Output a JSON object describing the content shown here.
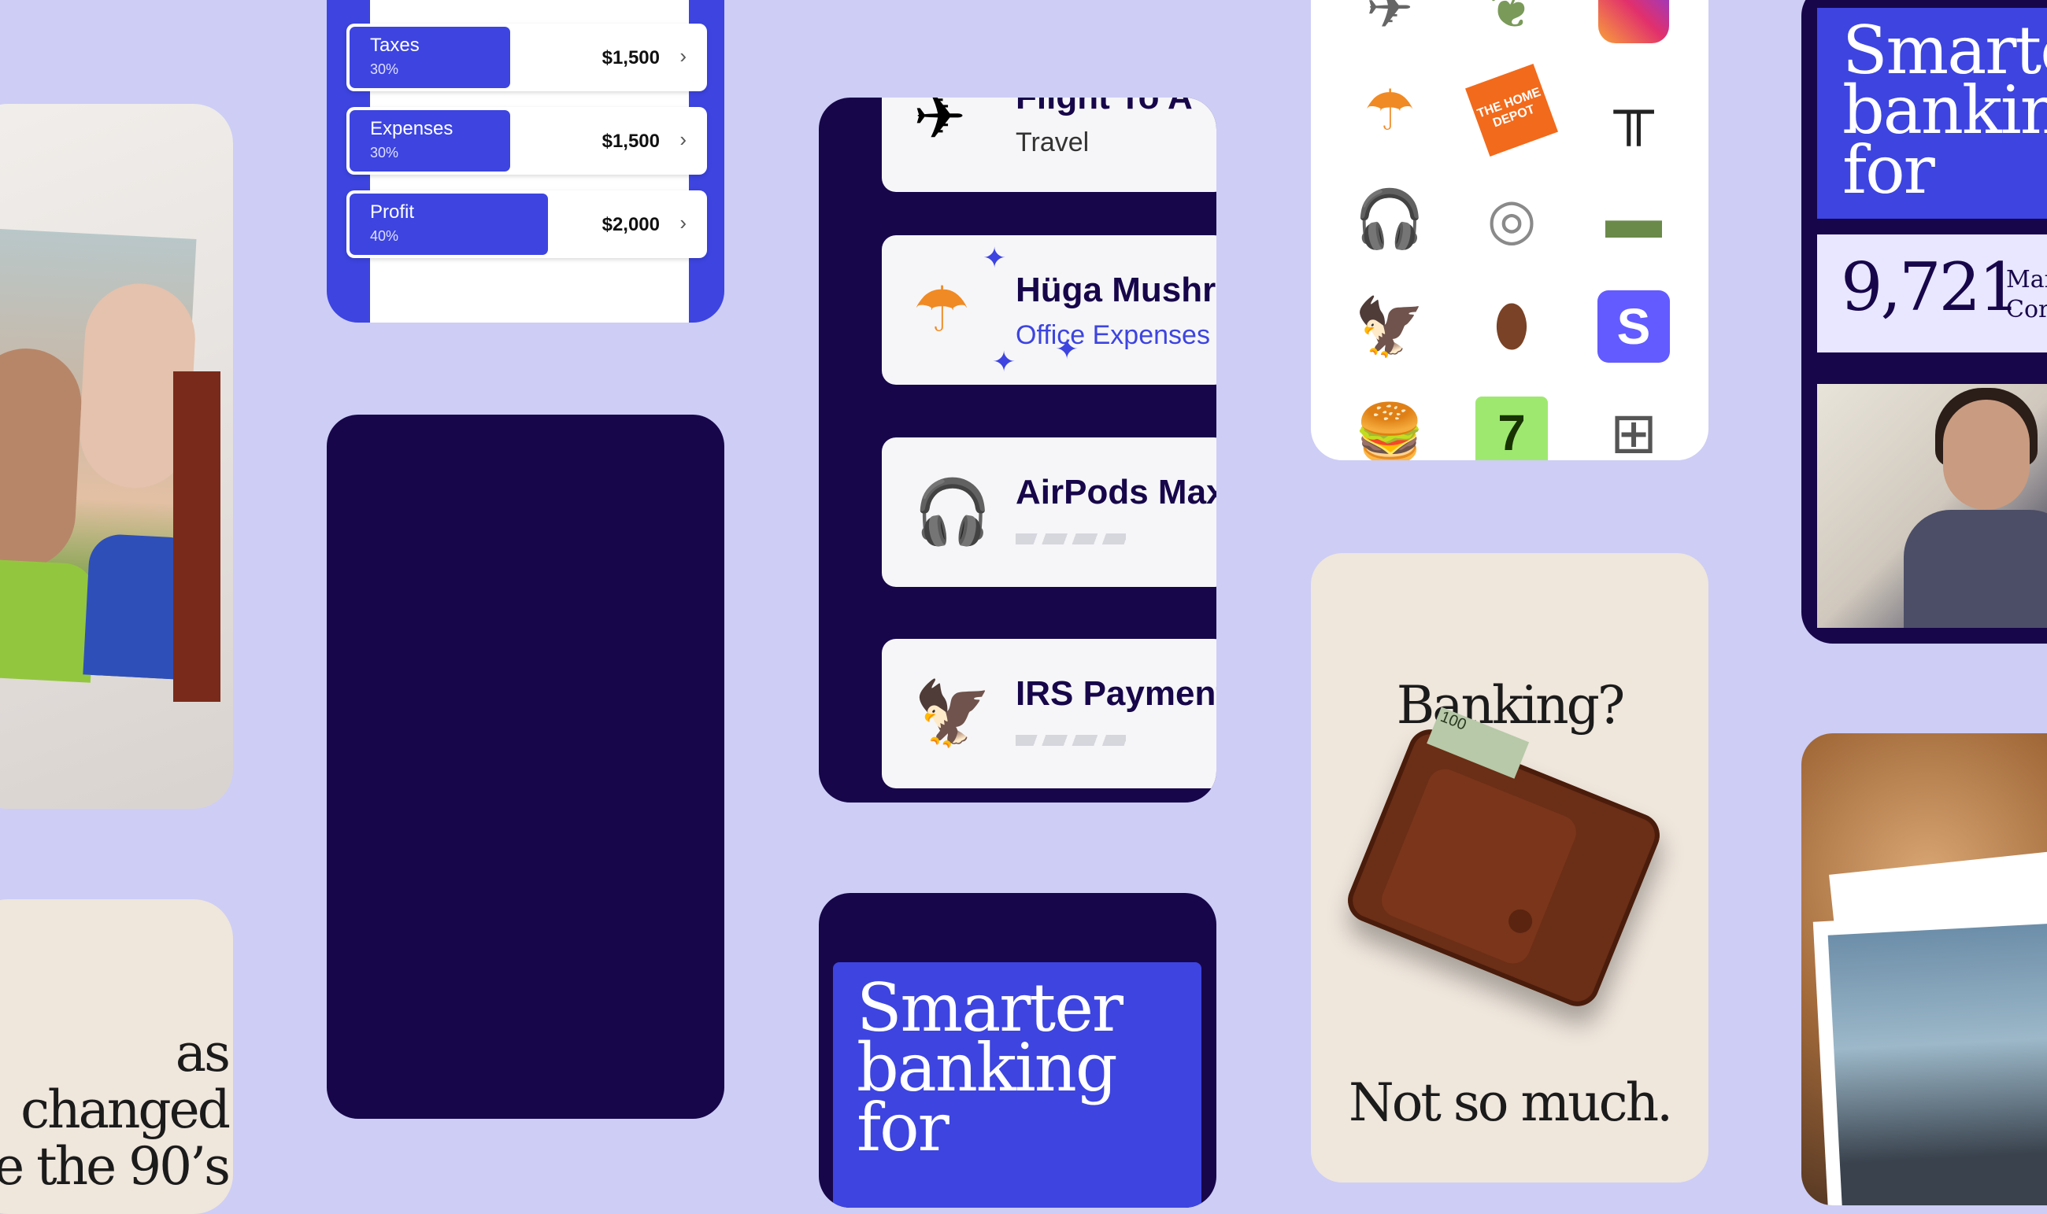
{
  "colors": {
    "background": "#cdcdf6",
    "brand_blue": "#3d44e0",
    "navy": "#17064a",
    "cream": "#efe6dc"
  },
  "text_card_left": {
    "lines": [
      "as changed",
      "e the 90’s"
    ]
  },
  "budget": {
    "rows": [
      {
        "label": "Taxes",
        "percent": "30%",
        "amount": "$1,500",
        "fill": 0.3
      },
      {
        "label": "Expenses",
        "percent": "30%",
        "amount": "$1,500",
        "fill": 0.3
      },
      {
        "label": "Profit",
        "percent": "40%",
        "amount": "$2,000",
        "fill": 0.4
      }
    ]
  },
  "transactions": {
    "items": [
      {
        "name": "Flight To A",
        "category": "Travel",
        "icon": "airplane-icon"
      },
      {
        "name": "Hüga Mushr",
        "category": "Office Expenses",
        "icon": "mushroom-lamp-icon"
      },
      {
        "name": "AirPods Max",
        "category": "",
        "icon": "headphones-icon"
      },
      {
        "name": "IRS Payment",
        "category": "",
        "icon": "irs-eagle-icon"
      }
    ]
  },
  "smarter_card": {
    "lines": [
      "Smarter",
      "banking",
      "for"
    ]
  },
  "merchant_grid": {
    "icons": [
      "airplane-icon",
      "plant-icon",
      "instagram-icon",
      "mushroom-lamp-icon",
      "home-depot-icon",
      "standing-desk-icon",
      "headphones-icon",
      "tape-dispenser-icon",
      "cash-stack-icon",
      "irs-eagle-icon",
      "coffee-bean-icon",
      "stripe-icon",
      "burger-icon",
      "wise-icon",
      "3d-printer-icon"
    ],
    "home_depot_text": "THE HOME DEPOT",
    "stripe_letter": "S",
    "wise_letter": "7"
  },
  "banking_card": {
    "question": "Banking?",
    "answer": "Not so much.",
    "bill_text": "100"
  },
  "smart_stats": {
    "title_lines": [
      "Smarte",
      "bankin",
      "for"
    ],
    "number": "9,721",
    "label_line1": "Mar",
    "label_line2": "Cor"
  }
}
